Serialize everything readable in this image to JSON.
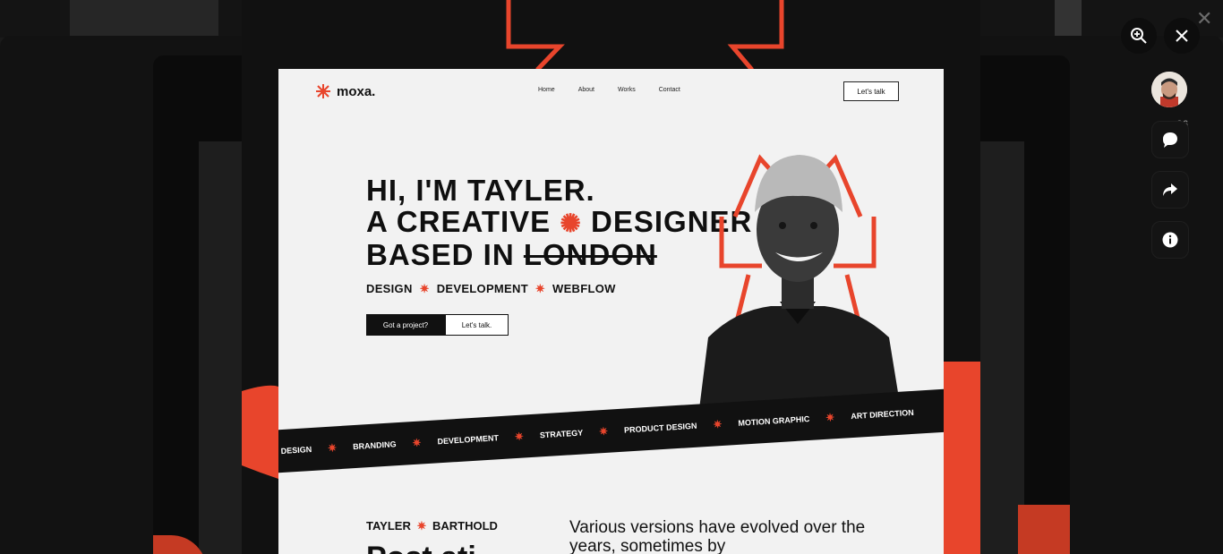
{
  "lightbox": {
    "colors": {
      "accent": "#e8452c",
      "dark": "#111111",
      "page": "#f2f2f2"
    }
  },
  "mockup": {
    "logo": "moxa.",
    "nav": [
      "Home",
      "About",
      "Works",
      "Contact"
    ],
    "cta": "Let's talk",
    "hero": {
      "line1": "HI, I'M TAYLER.",
      "line2a": "A CREATIVE",
      "line2b": "DESIGNER",
      "line3a": "BASED IN",
      "line3b": "LONDON"
    },
    "skills": [
      "DESIGN",
      "DEVELOPMENT",
      "WEBFLOW"
    ],
    "buttons": {
      "primary": "Got a project?",
      "secondary": "Let's talk."
    },
    "ribbon": [
      "DESIGN",
      "BRANDING",
      "DEVELOPMENT",
      "STRATEGY",
      "PRODUCT DESIGN",
      "MOTION GRAPHIC",
      "ART DIRECTION"
    ],
    "footer": {
      "first_name": "TAYLER",
      "last_name": "BARTHOLD",
      "big_text": "Post ati",
      "intro": "Various versions have evolved over the years, sometimes by accident,sometimes"
    }
  },
  "sidebar": {
    "comment_count": "26"
  },
  "icons": {
    "zoom": "zoom-in-icon",
    "close": "close-icon",
    "comment": "comment-icon",
    "share": "share-icon",
    "info": "info-icon"
  }
}
